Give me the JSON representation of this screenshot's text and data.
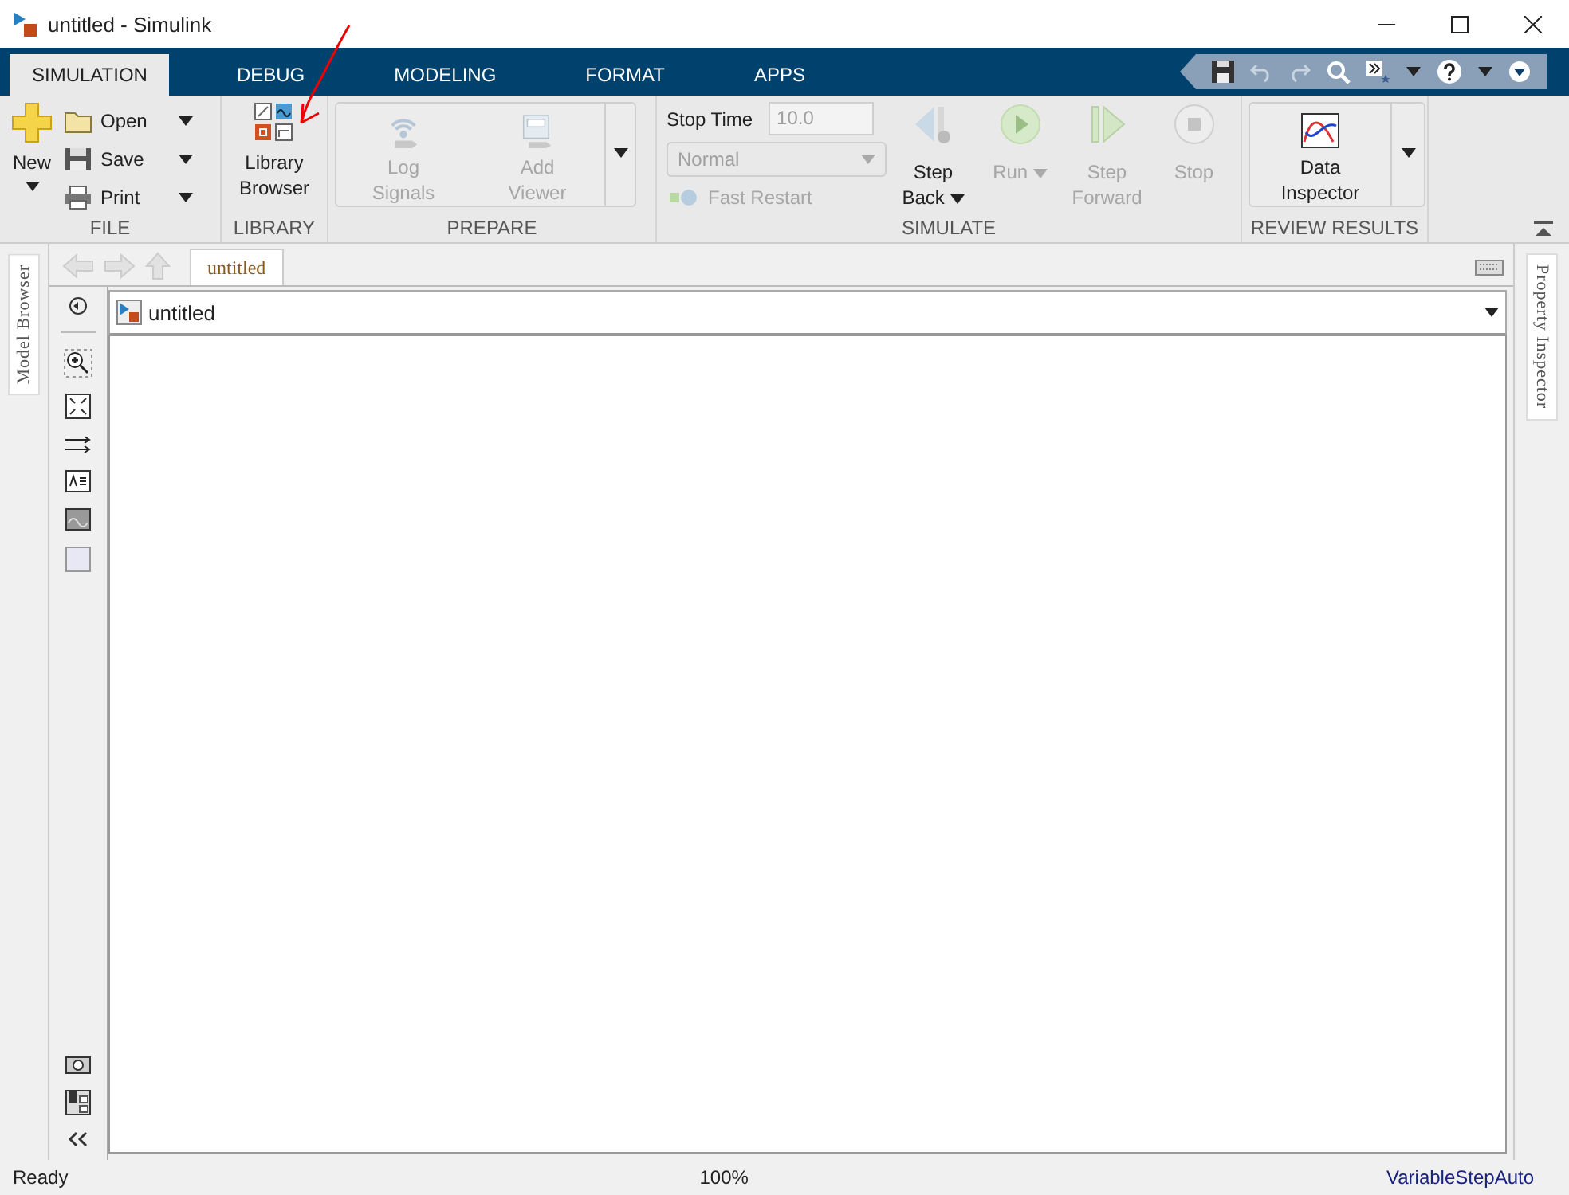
{
  "window": {
    "title": "untitled - Simulink"
  },
  "tabs": [
    {
      "label": "SIMULATION",
      "selected": true
    },
    {
      "label": "DEBUG",
      "selected": false
    },
    {
      "label": "MODELING",
      "selected": false
    },
    {
      "label": "FORMAT",
      "selected": false
    },
    {
      "label": "APPS",
      "selected": false
    }
  ],
  "file": {
    "label": "FILE",
    "new": {
      "label": "New"
    },
    "items": [
      {
        "kind": "open",
        "label": "Open"
      },
      {
        "kind": "save",
        "label": "Save"
      },
      {
        "kind": "print",
        "label": "Print"
      }
    ]
  },
  "library": {
    "label": "LIBRARY",
    "button": {
      "label": "Library Browser"
    }
  },
  "prepare": {
    "label": "PREPARE",
    "buttons": [
      {
        "kind": "log",
        "label": "Log Signals",
        "disabled": true
      },
      {
        "kind": "viewer",
        "label": "Add Viewer",
        "disabled": true
      }
    ]
  },
  "simulate": {
    "label": "SIMULATE",
    "stop_time_label": "Stop Time",
    "stop_time": "10.0",
    "mode": "Normal",
    "fast_restart": {
      "label": "Fast Restart",
      "disabled": true
    },
    "buttons": [
      {
        "kind": "step-back",
        "label": "Step Back",
        "disabled": false,
        "dropdown": true
      },
      {
        "kind": "run",
        "label": "Run",
        "disabled": true,
        "dropdown": true
      },
      {
        "kind": "step-forward",
        "label": "Step Forward",
        "disabled": true,
        "dropdown": false
      },
      {
        "kind": "stop",
        "label": "Stop",
        "disabled": true,
        "dropdown": false
      }
    ]
  },
  "review": {
    "label": "REVIEW RESULTS",
    "button": {
      "label": "Data Inspector"
    }
  },
  "editor": {
    "tab": {
      "label": "untitled",
      "selected": true
    },
    "breadcrumb": "untitled",
    "left_panel": "Model Browser",
    "right_panel": "Property Inspector"
  },
  "status_bar": {
    "state": "Ready",
    "zoom": "100%",
    "solver": "VariableStepAuto"
  }
}
